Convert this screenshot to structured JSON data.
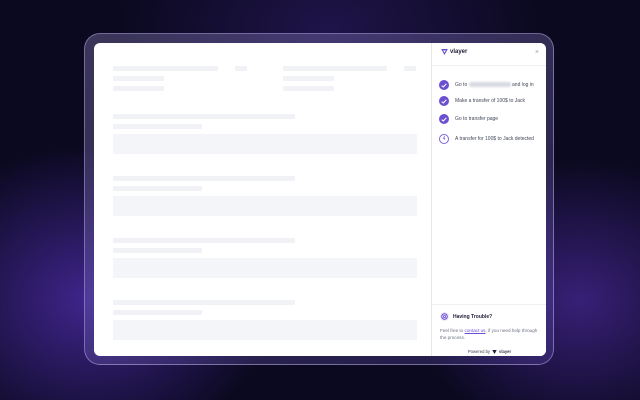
{
  "panel": {
    "brand": "vlayer",
    "close_glyph": "×",
    "steps": [
      {
        "status": "done",
        "before": "Go to",
        "after": "and log in"
      },
      {
        "status": "done",
        "text": "Make a transfer of 100$ to Jack"
      },
      {
        "status": "done",
        "text": "Go to transfer page"
      },
      {
        "status": "pending",
        "number": "4",
        "text": "A transfer for 100$ to Jack detected"
      }
    ],
    "help": {
      "title": "Having Trouble?",
      "text_before": "Feel free to",
      "link": "contact us",
      "text_after": ", if you need help through the process."
    },
    "powered_by": "Powered by",
    "powered_brand": "vlayer"
  },
  "colors": {
    "accent": "#6a4fd1",
    "background": "#0b0920"
  },
  "icons": {
    "check": "check-icon",
    "close": "close-icon",
    "help": "lifebuoy-icon",
    "logo": "vlayer-logo-icon"
  }
}
